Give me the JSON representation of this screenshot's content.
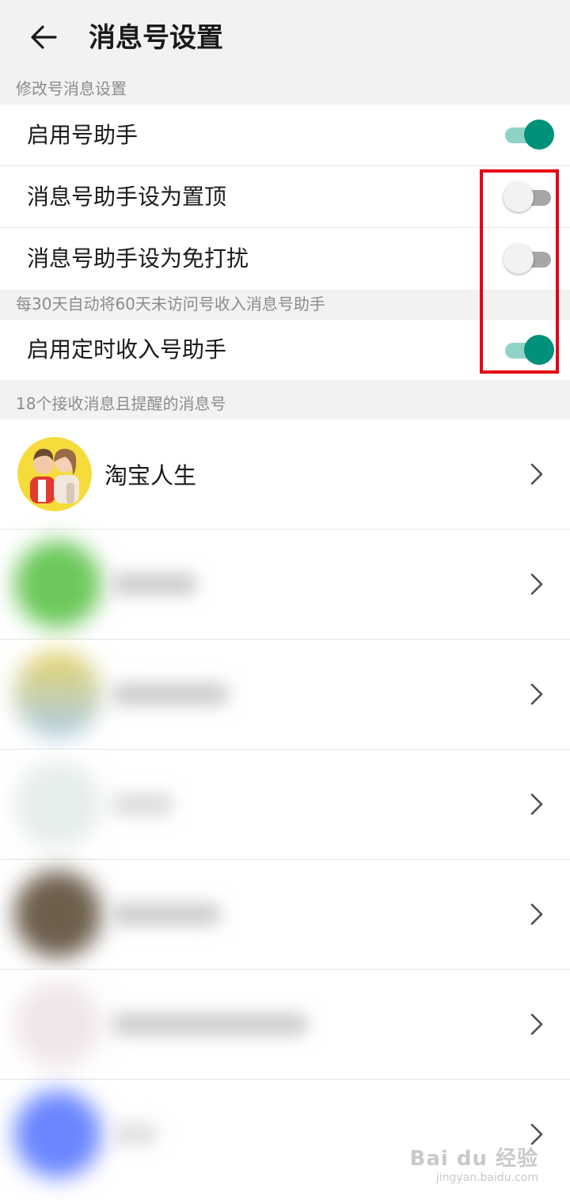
{
  "header": {
    "title": "消息号设置"
  },
  "sections": {
    "modify_label": "修改号消息设置",
    "auto_label": "每30天自动将60天未访问号收入消息号助手",
    "accounts_label": "18个接收消息且提醒的消息号"
  },
  "settings": [
    {
      "label": "启用号助手",
      "enabled": true
    },
    {
      "label": "消息号助手设为置顶",
      "enabled": false
    },
    {
      "label": "消息号助手设为免打扰",
      "enabled": false
    },
    {
      "label": "启用定时收入号助手",
      "enabled": true
    }
  ],
  "accounts": [
    {
      "name": "淘宝人生"
    }
  ],
  "colors": {
    "accent": "#00917a",
    "accent_track": "#8fd3c7",
    "highlight": "#e60012"
  },
  "watermark": {
    "logo": "Bai du 经验",
    "url": "jingyan.baidu.com"
  }
}
